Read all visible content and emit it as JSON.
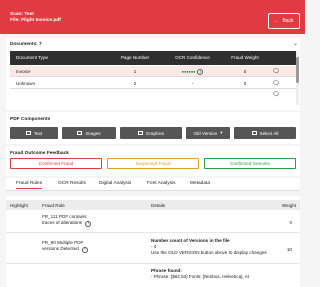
{
  "header": {
    "scan": "Scan: Test",
    "file": "File: Flight Invoice.pdf",
    "back": "Back"
  },
  "documents": {
    "title": "Documents: 7",
    "columns": [
      "Document Type",
      "Page Number",
      "OCR Confidence",
      "Fraud Weight"
    ],
    "rows": [
      {
        "type": "Invoice",
        "page": "1",
        "ocr": "●●●●●●",
        "weight": "0"
      },
      {
        "type": "Unknown",
        "page": "2",
        "ocr": "-",
        "weight": "0"
      }
    ]
  },
  "pdf_components": {
    "title": "PDF Components",
    "buttons": [
      "Text",
      "Images",
      "Graphics",
      "Old Version",
      "Select All"
    ]
  },
  "feedback": {
    "title": "Fraud Outcome Feedback",
    "buttons": [
      {
        "label": "Confirmed Fraud",
        "color": "#e23a42"
      },
      {
        "label": "Suspected Fraud",
        "color": "#e0a020"
      },
      {
        "label": "Confirmed Genuine",
        "color": "#27a043"
      }
    ]
  },
  "tabs": [
    "Fraud Rules",
    "OCR Results",
    "Digital Analysis",
    "Font Analysis",
    "Metadata"
  ],
  "rules": {
    "columns": [
      "Highlight",
      "Fraud Rule",
      "Details",
      "Weight"
    ],
    "rows": [
      {
        "rule": "FR_111 PDF contains traces of alterations",
        "detail_title": "",
        "detail_lines": [],
        "weight": "0"
      },
      {
        "rule": "FR_90 Multiple PDF versions Detected",
        "detail_title": "Number count of Versions in the file",
        "detail_lines": [
          "- 4",
          "Use the OLD VERSION button above to display changes"
        ],
        "weight": "10"
      },
      {
        "rule": "",
        "detail_title": "Phrase found:",
        "detail_lines": [
          "- Phrase: [$62.53] Fonts: [Nimbus, Helvetica], At"
        ],
        "weight": ""
      }
    ]
  },
  "colors": {
    "accent": "#e23a42",
    "dark": "#2f2f2f",
    "ok": "#27a043"
  }
}
